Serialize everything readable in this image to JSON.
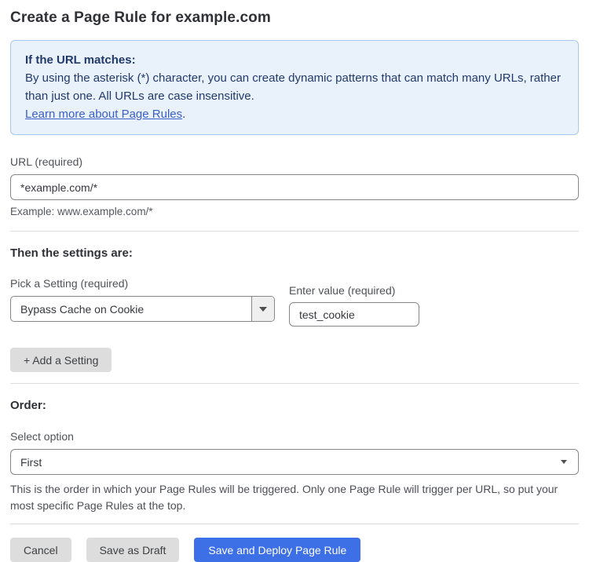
{
  "page": {
    "title": "Create a Page Rule for example.com"
  },
  "info_box": {
    "heading": "If the URL matches:",
    "body": "By using the asterisk (*) character, you can create dynamic patterns that can match many URLs, rather than just one. All URLs are case insensitive.",
    "link_label": "Learn more about Page Rules",
    "link_suffix": "."
  },
  "url_field": {
    "label": "URL (required)",
    "value": "*example.com/*",
    "helper": "Example: www.example.com/*"
  },
  "settings_section": {
    "heading": "Then the settings are:",
    "setting_label": "Pick a Setting (required)",
    "setting_value": "Bypass Cache on Cookie",
    "value_label": "Enter value (required)",
    "value_value": "test_cookie",
    "add_button_label": "+ Add a Setting"
  },
  "order_section": {
    "heading": "Order:",
    "select_label": "Select option",
    "select_value": "First",
    "helper": "This is the order in which your Page Rules will be triggered. Only one Page Rule will trigger per URL, so put your most specific Page Rules at the top."
  },
  "footer": {
    "cancel_label": "Cancel",
    "save_draft_label": "Save as Draft",
    "save_deploy_label": "Save and Deploy Page Rule"
  },
  "icons": {
    "dropdown_caret": "caret-down-icon"
  },
  "colors": {
    "accent_blue": "#3d6fe7",
    "info_background": "#e9f1fb",
    "info_border": "#a8c8f0",
    "info_text": "#223a6b",
    "link_blue": "#3a5fc8",
    "button_gray": "#dddddd",
    "input_border": "#85878a",
    "divider": "#dcdcdc"
  }
}
